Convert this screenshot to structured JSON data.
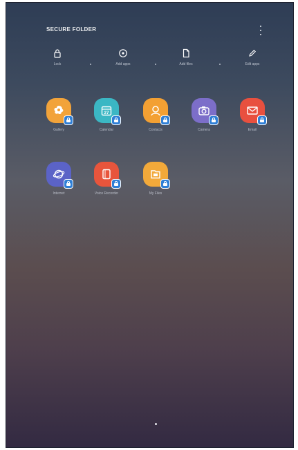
{
  "header": {
    "title": "SECURE FOLDER",
    "more_icon": "more-options-icon"
  },
  "quick_actions": [
    {
      "label": "Lock",
      "icon": "lock-icon"
    },
    {
      "label": "Add apps",
      "icon": "add-icon"
    },
    {
      "label": "Add files",
      "icon": "file-icon"
    },
    {
      "label": "Edit apps",
      "icon": "pencil-icon"
    }
  ],
  "apps_row1": [
    {
      "label": "Gallery",
      "icon": "gallery-icon",
      "color": "#f2a33a"
    },
    {
      "label": "Calendar",
      "icon": "calendar-icon",
      "color": "#3bb7c4"
    },
    {
      "label": "Contacts",
      "icon": "contacts-icon",
      "color": "#f3a033"
    },
    {
      "label": "Camera",
      "icon": "camera-icon",
      "color": "#7c6ec9"
    },
    {
      "label": "Email",
      "icon": "email-icon",
      "color": "#e8503f"
    }
  ],
  "apps_row2": [
    {
      "label": "Internet",
      "icon": "internet-icon",
      "color": "#5b63c7"
    },
    {
      "label": "Voice Recorder",
      "icon": "voice-recorder-icon",
      "color": "#e8553c"
    },
    {
      "label": "My Files",
      "icon": "my-files-icon",
      "color": "#f2a93a"
    }
  ],
  "lock_badge_color": "#2f7fd6"
}
